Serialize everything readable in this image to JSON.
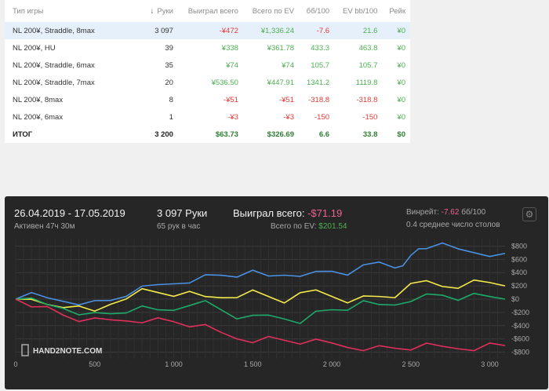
{
  "table": {
    "headers": [
      "Тип игры",
      "Руки",
      "Выиграл всего",
      "Всего по EV",
      "бб/100",
      "EV bb/100",
      "Рейк"
    ],
    "rows": [
      {
        "game": "NL 200¥, Straddle, 8max",
        "hands": "3 097",
        "won": "-¥472",
        "ev": "¥1,336.24",
        "bb": "-7.6",
        "evbb": "21.6",
        "rake": "¥0",
        "selected": true
      },
      {
        "game": "NL 200¥, HU",
        "hands": "39",
        "won": "¥338",
        "ev": "¥361.78",
        "bb": "433.3",
        "evbb": "463.8",
        "rake": "¥0"
      },
      {
        "game": "NL 200¥, Straddle, 6max",
        "hands": "35",
        "won": "¥74",
        "ev": "¥74",
        "bb": "105.7",
        "evbb": "105.7",
        "rake": "¥0"
      },
      {
        "game": "NL 200¥, Straddle, 7max",
        "hands": "20",
        "won": "¥536.50",
        "ev": "¥447.91",
        "bb": "1341.2",
        "evbb": "1119.8",
        "rake": "¥0"
      },
      {
        "game": "NL 200¥, 8max",
        "hands": "8",
        "won": "-¥51",
        "ev": "-¥51",
        "bb": "-318.8",
        "evbb": "-318.8",
        "rake": "¥0"
      },
      {
        "game": "NL 200¥, 6max",
        "hands": "1",
        "won": "-¥3",
        "ev": "-¥3",
        "bb": "-150",
        "evbb": "-150",
        "rake": "¥0"
      }
    ],
    "total": {
      "game": "ИТОГ",
      "hands": "3 200",
      "won": "$63.73",
      "ev": "$326.69",
      "bb": "6.6",
      "evbb": "33.8",
      "rake": "$0"
    }
  },
  "panel": {
    "date_range": "26.04.2019 - 17.05.2019",
    "active": "Активен 47ч 30м",
    "hands": "3 097 Руки",
    "hands_per_hour": "65 рук в час",
    "won_label": "Выиграл всего:",
    "won_value": "-$71.19",
    "ev_label": "Всего по EV:",
    "ev_value": "$201.54",
    "winrate_label": "Винрейт:",
    "winrate_value": "-7.62",
    "winrate_unit": "бб/100",
    "tables": "0.4 среднее число столов",
    "logo": "HAND2NOTE.COM",
    "colors": {
      "won_neg": "#f06292",
      "ev_pos": "#4caf50",
      "blue": "#4a90e2",
      "yellow": "#f5e94b",
      "green": "#1faa6a",
      "pink": "#e0305a"
    }
  },
  "chart_data": {
    "type": "line",
    "xlim": [
      0,
      3097
    ],
    "ylim": [
      -900,
      900
    ],
    "xticks": [
      0,
      500,
      1000,
      1500,
      2000,
      2500,
      3000
    ],
    "xtick_labels": [
      "0",
      "500",
      "1 000",
      "1 500",
      "2 000",
      "2 500",
      "3 000"
    ],
    "yticks": [
      800,
      600,
      400,
      200,
      0,
      -200,
      -400,
      -600,
      -800
    ],
    "ytick_labels": [
      "$800",
      "$600",
      "$400",
      "$200",
      "$0",
      "-$200",
      "-$400",
      "-$600",
      "-$800"
    ],
    "series": [
      {
        "color": "#4a90e2",
        "x": [
          0,
          100,
          200,
          400,
          500,
          600,
          700,
          800,
          900,
          1000,
          1100,
          1200,
          1300,
          1400,
          1500,
          1600,
          1700,
          1800,
          1900,
          2000,
          2100,
          2200,
          2300,
          2400,
          2450,
          2500,
          2550,
          2600,
          2700,
          2800,
          2900,
          3000,
          3097
        ],
        "y": [
          0,
          80,
          40,
          -30,
          -60,
          -20,
          80,
          140,
          200,
          250,
          300,
          330,
          360,
          370,
          380,
          330,
          380,
          400,
          380,
          420,
          400,
          460,
          540,
          490,
          560,
          620,
          760,
          800,
          790,
          740,
          720,
          700,
          690
        ]
      },
      {
        "color": "#f5e94b",
        "x": [
          0,
          100,
          200,
          300,
          400,
          500,
          600,
          700,
          800,
          900,
          1000,
          1100,
          1200,
          1300,
          1400,
          1500,
          1600,
          1700,
          1800,
          1900,
          2000,
          2100,
          2200,
          2300,
          2400,
          2500,
          2600,
          2700,
          2800,
          2900,
          3000,
          3097
        ],
        "y": [
          0,
          -40,
          -80,
          -90,
          -160,
          -200,
          -60,
          60,
          120,
          100,
          80,
          60,
          20,
          40,
          80,
          100,
          40,
          -20,
          40,
          120,
          60,
          0,
          10,
          40,
          60,
          180,
          260,
          210,
          220,
          250,
          250,
          200
        ]
      },
      {
        "color": "#1faa6a",
        "x": [
          0,
          100,
          200,
          300,
          400,
          500,
          600,
          700,
          800,
          900,
          1000,
          1100,
          1200,
          1300,
          1400,
          1500,
          1600,
          1700,
          1800,
          1900,
          2000,
          2100,
          2200,
          2300,
          2400,
          2500,
          2600,
          2700,
          2800,
          2900,
          3000,
          3097
        ],
        "y": [
          0,
          -40,
          -100,
          -120,
          -180,
          -240,
          -220,
          -170,
          -160,
          -180,
          -150,
          -40,
          -60,
          -160,
          -260,
          -300,
          -260,
          -280,
          -310,
          -220,
          -160,
          -130,
          -80,
          -100,
          -70,
          20,
          40,
          60,
          20,
          30,
          20,
          0
        ]
      },
      {
        "color": "#e0305a",
        "x": [
          0,
          100,
          200,
          300,
          400,
          500,
          600,
          700,
          800,
          900,
          1000,
          1100,
          1200,
          1300,
          1400,
          1500,
          1600,
          1700,
          1800,
          1900,
          2000,
          2100,
          2200,
          2300,
          2400,
          2500,
          2600,
          2700,
          2800,
          2900,
          3000,
          3097
        ],
        "y": [
          0,
          -60,
          -150,
          -240,
          -300,
          -340,
          -330,
          -310,
          -300,
          -320,
          -340,
          -380,
          -440,
          -520,
          -580,
          -600,
          -600,
          -620,
          -640,
          -660,
          -680,
          -710,
          -720,
          -740,
          -740,
          -730,
          -720,
          -730,
          -730,
          -720,
          -700,
          -700
        ]
      }
    ]
  }
}
